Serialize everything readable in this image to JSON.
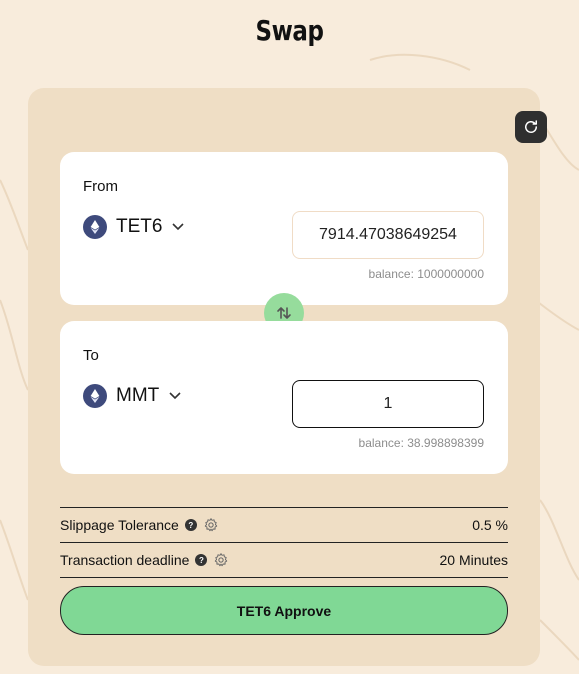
{
  "page": {
    "title": "Swap"
  },
  "from": {
    "label": "From",
    "token": "TET6",
    "token_icon": "ethereum-icon",
    "amount": "7914.47038649254",
    "balance": "balance: 1000000000"
  },
  "to": {
    "label": "To",
    "token": "MMT",
    "token_icon": "ethereum-icon",
    "amount": "1",
    "balance": "balance: 38.998898399"
  },
  "settings": {
    "slippage_label": "Slippage Tolerance",
    "slippage_value": "0.5 %",
    "deadline_label": "Transaction deadline",
    "deadline_value": "20 Minutes",
    "help_glyph": "?"
  },
  "actions": {
    "approve_label": "TET6 Approve",
    "refresh_icon": "refresh-icon",
    "swap_icon": "swap-direction-icon"
  },
  "colors": {
    "background": "#f8ecdc",
    "panel": "#efdec5",
    "accent_green": "#80d895",
    "token_badge": "#3e4a7c"
  }
}
